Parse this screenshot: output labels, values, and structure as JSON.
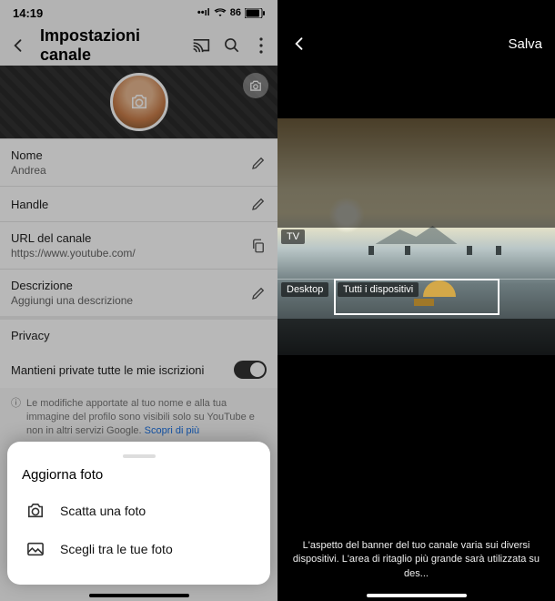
{
  "left": {
    "status": {
      "time": "14:19",
      "battery": "86"
    },
    "header": {
      "title": "Impostazioni canale"
    },
    "rows": {
      "name_label": "Nome",
      "name_value": "Andrea",
      "handle_label": "Handle",
      "url_label": "URL del canale",
      "url_value": "https://www.youtube.com/",
      "desc_label": "Descrizione",
      "desc_placeholder": "Aggiungi una descrizione",
      "privacy_heading": "Privacy",
      "privacy_toggle_label": "Mantieni private tutte le mie iscrizioni"
    },
    "info": {
      "text": "Le modifiche apportate al tuo nome e alla tua immagine del profilo sono visibili solo su YouTube e non in altri servizi Google. ",
      "link": "Scopri di più"
    },
    "sheet": {
      "title": "Aggiorna foto",
      "take": "Scatta una foto",
      "choose": "Scegli tra le tue foto"
    }
  },
  "right": {
    "save": "Salva",
    "labels": {
      "tv": "TV",
      "desktop": "Desktop",
      "all": "Tutti i dispositivi"
    },
    "caption_l1": "L'aspetto del banner del tuo canale varia sui diversi",
    "caption_l2": "dispositivi. L'area di ritaglio più grande sarà utilizzata su des..."
  }
}
